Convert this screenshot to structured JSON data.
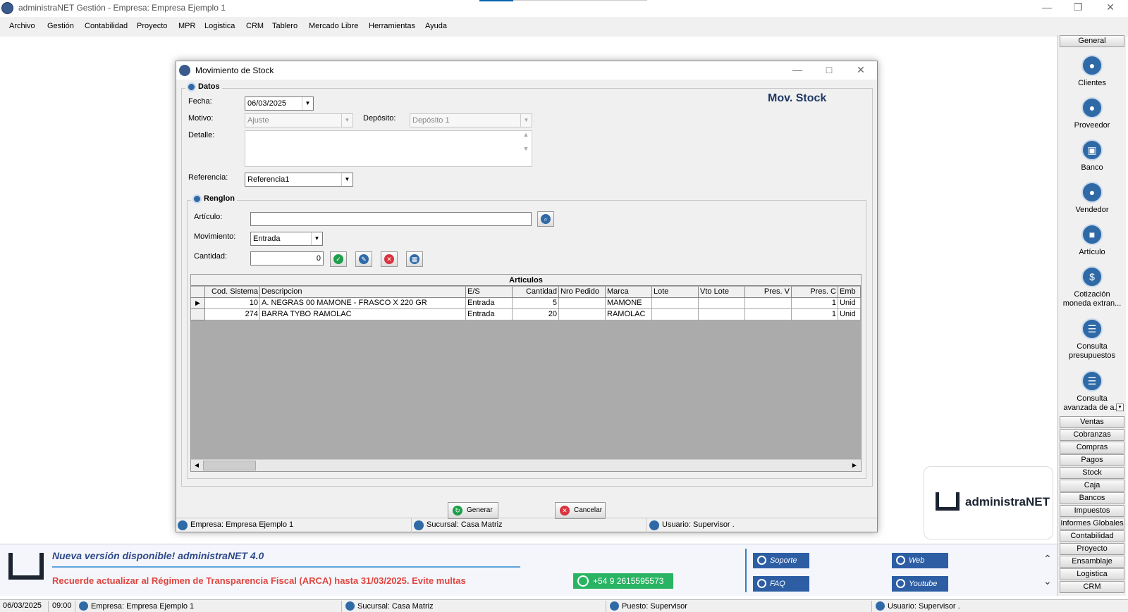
{
  "app": {
    "title": "administraNET Gestión - Empresa: Empresa Ejemplo 1"
  },
  "menu": [
    "Archivo",
    "Gestión",
    "Contabilidad",
    "Proyecto",
    "MPR",
    "Logistica",
    "CRM",
    "Tablero",
    "Mercado Libre",
    "Herramientas",
    "Ayuda"
  ],
  "sidepanel": {
    "header": "General",
    "items": [
      {
        "label": "Clientes",
        "icon": "clients-icon"
      },
      {
        "label": "Proveedor",
        "icon": "supplier-icon"
      },
      {
        "label": "Banco",
        "icon": "bank-icon"
      },
      {
        "label": "Vendedor",
        "icon": "seller-icon"
      },
      {
        "label": "Artículo",
        "icon": "article-box-icon"
      },
      {
        "label": "Cotización moneda extran...",
        "icon": "currency-icon"
      },
      {
        "label": "Consulta presupuestos",
        "icon": "document-icon"
      },
      {
        "label": "Consulta avanzada de a...",
        "icon": "phone-doc-icon"
      }
    ],
    "sections": [
      "Ventas",
      "Cobranzas",
      "Compras",
      "Pagos",
      "Stock",
      "Caja",
      "Bancos",
      "Impuestos",
      "Informes Globales",
      "Contabilidad",
      "Proyecto",
      "Ensamblaje",
      "Logistica",
      "CRM"
    ]
  },
  "logo": {
    "text": "administraNET"
  },
  "dialog": {
    "title": "Movimiento de Stock",
    "heading": "Mov. Stock",
    "datos": {
      "legend": "Datos",
      "fecha_label": "Fecha:",
      "fecha": "06/03/2025",
      "motivo_label": "Motivo:",
      "motivo": "Ajuste",
      "deposito_label": "Depósito:",
      "deposito": "Depósito 1",
      "detalle_label": "Detalle:",
      "referencia_label": "Referencia:",
      "referencia": "Referencia1"
    },
    "renglon": {
      "legend": "Renglon",
      "articulo_label": "Artículo:",
      "movimiento_label": "Movimiento:",
      "movimiento": "Entrada",
      "cantidad_label": "Cantidad:",
      "cantidad": "0"
    },
    "grid": {
      "caption": "Articulos",
      "columns": [
        "Cod. Sistema",
        "Descripcion",
        "E/S",
        "Cantidad",
        "Nro Pedido",
        "Marca",
        "Lote",
        "Vto Lote",
        "Pres. V",
        "Pres. C",
        "Emb"
      ],
      "rows": [
        [
          "10",
          "A. NEGRAS 00 MAMONE - FRASCO X 220 GR",
          "Entrada",
          "5",
          "",
          "MAMONE",
          "",
          "",
          "",
          "1",
          "Unid"
        ],
        [
          "274",
          "BARRA TYBO RAMOLAC",
          "Entrada",
          "20",
          "",
          "RAMOLAC",
          "",
          "",
          "",
          "1",
          "Unid"
        ]
      ]
    },
    "buttons": {
      "generar": "Generar",
      "cancelar": "Cancelar"
    },
    "status": {
      "empresa": "Empresa: Empresa Ejemplo 1",
      "sucursal": "Sucursal: Casa Matriz",
      "usuario": "Usuario: Supervisor ."
    }
  },
  "banner": {
    "title": "Nueva versión disponible! administraNET 4.0",
    "warning": "Recuerde actualizar al Régimen de Transparencia Fiscal (ARCA) hasta 31/03/2025. Evite multas",
    "whatsapp": "+54 9 2615595573",
    "links": {
      "soporte": "Soporte",
      "web": "Web",
      "faq": "FAQ",
      "youtube": "Youtube"
    }
  },
  "statusbar": {
    "date": "06/03/2025",
    "time": "09:00",
    "empresa": "Empresa: Empresa Ejemplo 1",
    "sucursal": "Sucursal: Casa Matriz",
    "puesto": "Puesto: Supervisor",
    "usuario": "Usuario: Supervisor ."
  },
  "colors": {
    "accent": "#1f3864",
    "warning": "#e0453f",
    "whatsapp": "#29b463",
    "link": "#2d5ea4"
  }
}
